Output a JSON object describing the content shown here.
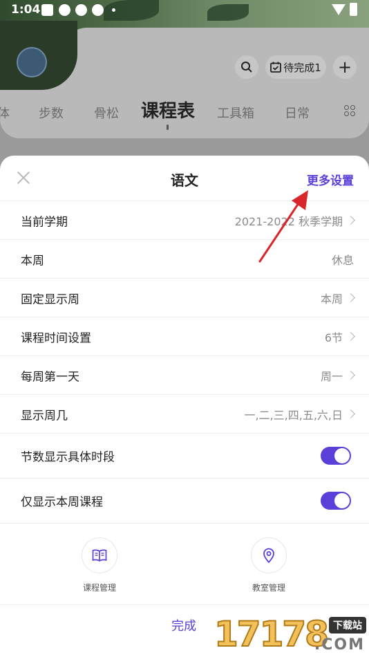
{
  "status_bar": {
    "time": "1:04"
  },
  "header": {
    "pending_label": "待完成1",
    "tabs": [
      {
        "label": "体",
        "active": false
      },
      {
        "label": "步数",
        "active": false
      },
      {
        "label": "骨松",
        "active": false
      },
      {
        "label": "课程表",
        "active": true
      },
      {
        "label": "工具箱",
        "active": false
      },
      {
        "label": "日常",
        "active": false
      }
    ]
  },
  "sheet": {
    "title": "语文",
    "more_settings": "更多设置",
    "rows": [
      {
        "label": "当前学期",
        "value": "2021-2022 秋季学期",
        "chevron": true
      },
      {
        "label": "本周",
        "value": "休息",
        "chevron": false
      },
      {
        "label": "固定显示周",
        "value": "本周",
        "chevron": true
      },
      {
        "label": "课程时间设置",
        "value": "6节",
        "chevron": true
      },
      {
        "label": "每周第一天",
        "value": "周一",
        "chevron": true
      },
      {
        "label": "显示周几",
        "value": "一,二,三,四,五,六,日",
        "chevron": true
      }
    ],
    "toggles": [
      {
        "label": "节数显示具体时段",
        "on": true
      },
      {
        "label": "仅显示本周课程",
        "on": true
      }
    ],
    "tools": [
      {
        "label": "课程管理",
        "icon": "book-icon"
      },
      {
        "label": "教室管理",
        "icon": "location-pin-icon"
      }
    ],
    "done_label": "完成"
  },
  "watermark": {
    "number": "17178",
    "tag": "下载站",
    "domain": ".COM"
  },
  "colors": {
    "accent": "#5b3fd8",
    "annotation_arrow": "#d9262a"
  }
}
